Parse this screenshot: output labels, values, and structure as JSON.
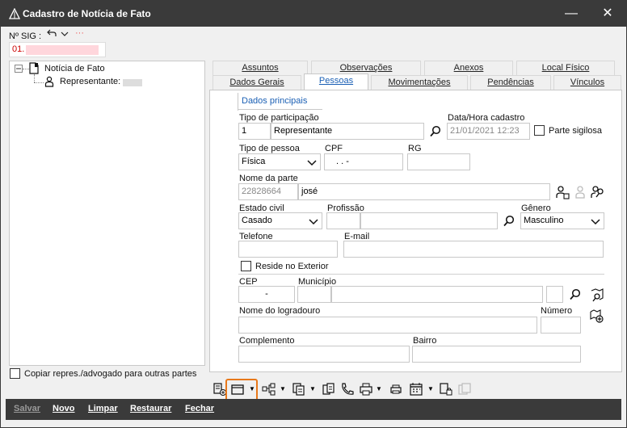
{
  "window": {
    "title": "Cadastro de Notícia de Fato",
    "minimize": "—",
    "close": "✕"
  },
  "sig": {
    "label": "Nº SIG :",
    "value": "01."
  },
  "tree": {
    "root": "Notícia de Fato",
    "child": "Representante:"
  },
  "copy_checkbox_label": "Copiar repres./advogado para outras partes",
  "tabs_top": [
    "Assuntos",
    "Observações",
    "Anexos",
    "Local Físico"
  ],
  "tabs_bottom": [
    "Dados Gerais",
    "Pessoas",
    "Movimentações",
    "Pendências",
    "Vínculos"
  ],
  "subtab": "Dados principais",
  "form": {
    "tipo_participacao_label": "Tipo de participação",
    "tipo_participacao_code": "1",
    "tipo_participacao_value": "Representante",
    "data_hora_label": "Data/Hora cadastro",
    "data_hora_value": "21/01/2021 12:23",
    "parte_sigilosa_label": "Parte sigilosa",
    "tipo_pessoa_label": "Tipo de pessoa",
    "tipo_pessoa_value": "Física",
    "cpf_label": "CPF",
    "cpf_value": ".  .  -",
    "rg_label": "RG",
    "nome_parte_label": "Nome da parte",
    "nome_parte_code": "22828664",
    "nome_parte_value": "josé",
    "estado_civil_label": "Estado civil",
    "estado_civil_value": "Casado",
    "profissao_label": "Profissão",
    "genero_label": "Gênero",
    "genero_value": "Masculino",
    "telefone_label": "Telefone",
    "email_label": "E-mail",
    "reside_exterior_label": "Reside no Exterior",
    "cep_label": "CEP",
    "cep_value": "-",
    "municipio_label": "Município",
    "logradouro_label": "Nome do logradouro",
    "numero_label": "Número",
    "complemento_label": "Complemento",
    "bairro_label": "Bairro"
  },
  "bottom_buttons": {
    "salvar": "Salvar",
    "novo": "Novo",
    "limpar": "Limpar",
    "restaurar": "Restaurar",
    "fechar": "Fechar"
  },
  "colors": {
    "titlebar": "#3a3a3a",
    "accent": "#1a5fb4",
    "highlight": "#e8781a"
  }
}
